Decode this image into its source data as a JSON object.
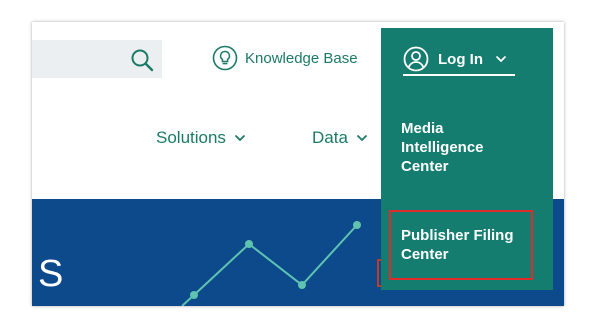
{
  "search": {
    "icon": "search-icon"
  },
  "header": {
    "knowledge_base": {
      "icon": "lightbulb-icon",
      "label": "Knowledge Base"
    }
  },
  "nav": {
    "items": [
      {
        "label": "Solutions",
        "icon": "chevron-down-icon"
      },
      {
        "label": "Data",
        "icon": "chevron-down-icon"
      }
    ]
  },
  "hero": {
    "heading_fragment": "S"
  },
  "account_menu": {
    "login": {
      "icon": "user-circle-icon",
      "label": "Log In",
      "chevron": "chevron-down-icon"
    },
    "items": [
      {
        "lines": [
          "Media",
          "Intelligence",
          "Center"
        ]
      },
      {
        "lines": [
          "Publisher Filing",
          "Center"
        ],
        "highlighted": true
      }
    ]
  },
  "colors": {
    "brand_teal": "#1b7a67",
    "menu_background": "#157d6f",
    "hero_blue": "#0d4a8c",
    "chart_line": "#5ec4b0",
    "highlight_red": "#e02b2b"
  }
}
